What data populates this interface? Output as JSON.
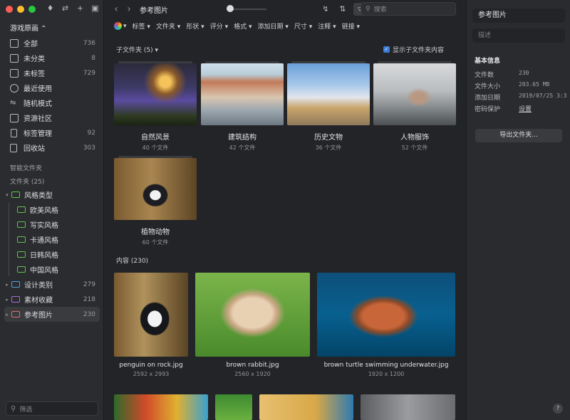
{
  "sidebar": {
    "library_name": "游戏原画 ⌃",
    "nav": [
      {
        "label": "全部",
        "count": "736",
        "icon": "inbox-icon"
      },
      {
        "label": "未分类",
        "count": "8",
        "icon": "unfiled-icon"
      },
      {
        "label": "未标签",
        "count": "729",
        "icon": "untagged-icon"
      },
      {
        "label": "最近使用",
        "count": "",
        "icon": "clock-icon"
      },
      {
        "label": "随机模式",
        "count": "",
        "icon": "shuffle-icon"
      },
      {
        "label": "资源社区",
        "count": "",
        "icon": "community-icon"
      },
      {
        "label": "标签管理",
        "count": "92",
        "icon": "bookmark-icon"
      },
      {
        "label": "回收站",
        "count": "303",
        "icon": "trash-icon"
      }
    ],
    "smart_folders_title": "智能文件夹",
    "folders_title": "文件夹 (25)",
    "folders": [
      {
        "label": "风格类型",
        "count": "",
        "color": "#5ec24a",
        "level": 0,
        "caret": "▾"
      },
      {
        "label": "欧美风格",
        "count": "",
        "color": "#5ec24a",
        "level": 1,
        "caret": ""
      },
      {
        "label": "写实风格",
        "count": "",
        "color": "#5ec24a",
        "level": 1,
        "caret": ""
      },
      {
        "label": "卡通风格",
        "count": "",
        "color": "#5ec24a",
        "level": 1,
        "caret": ""
      },
      {
        "label": "日韩风格",
        "count": "",
        "color": "#5ec24a",
        "level": 1,
        "caret": ""
      },
      {
        "label": "中国风格",
        "count": "",
        "color": "#5ec24a",
        "level": 1,
        "caret": ""
      },
      {
        "label": "设计类别",
        "count": "279",
        "color": "#4a9fe0",
        "level": 0,
        "caret": "▸"
      },
      {
        "label": "素材收藏",
        "count": "218",
        "color": "#a86fd6",
        "level": 0,
        "caret": "▸"
      },
      {
        "label": "参考图片",
        "count": "230",
        "color": "#d9706f",
        "level": 0,
        "caret": "▸",
        "selected": true
      }
    ],
    "filter_placeholder": "筛选"
  },
  "toolbar": {
    "title": "参考图片",
    "search_placeholder": "搜索"
  },
  "filters": [
    "标签 ▾",
    "文件夹 ▾",
    "形状 ▾",
    "评分 ▾",
    "格式 ▾",
    "添加日期 ▾",
    "尺寸 ▾",
    "注释 ▾",
    "链接 ▾"
  ],
  "subfolders": {
    "header": "子文件夹 (5) ▾",
    "show_label": "显示子文件夹内容",
    "items": [
      {
        "name": "自然风景",
        "meta": "40 个文件"
      },
      {
        "name": "建筑结构",
        "meta": "42 个文件"
      },
      {
        "name": "历史文物",
        "meta": "36 个文件"
      },
      {
        "name": "人物服饰",
        "meta": "52 个文件"
      },
      {
        "name": "植物动物",
        "meta": "60 个文件"
      }
    ]
  },
  "content": {
    "header": "内容 (230)",
    "items": [
      {
        "name": "penguin on rock.jpg",
        "dim": "2592 x 2993"
      },
      {
        "name": "brown rabbit.jpg",
        "dim": "2560 x 1920"
      },
      {
        "name": "brown turtle swimming underwater.jpg",
        "dim": "1920 x 1200"
      }
    ]
  },
  "inspector": {
    "title": "参考图片",
    "desc_placeholder": "描述",
    "section": "基本信息",
    "rows": [
      {
        "k": "文件数",
        "v": "230"
      },
      {
        "k": "文件大小",
        "v": "203.65 MB"
      },
      {
        "k": "添加日期",
        "v": "2019/07/25 3:3"
      },
      {
        "k": "密码保护",
        "v": "设置"
      }
    ],
    "export_label": "导出文件夹...",
    "help": "?"
  },
  "colors": {
    "accent": "#3d7dd8",
    "close": "#fe5f57",
    "minimize": "#febc2e",
    "zoom": "#28c840"
  }
}
